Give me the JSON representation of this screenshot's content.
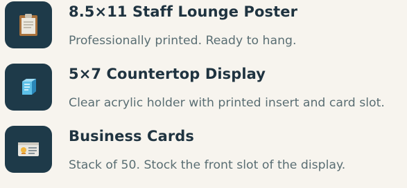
{
  "items": [
    {
      "title": "8.5×11 Staff Lounge Poster",
      "description": "Professionally printed. Ready to hang.",
      "icon": "clipboard-icon"
    },
    {
      "title": "5×7 Countertop Display",
      "description": "Clear acrylic holder with printed insert and card slot.",
      "icon": "acrylic-block-icon"
    },
    {
      "title": "Business Cards",
      "description": "Stack of 50. Stock the front slot of the display.",
      "icon": "id-card-icon"
    }
  ],
  "colors": {
    "background": "#f7f4ee",
    "tile": "#1e3a49",
    "title": "#1f3340",
    "description": "#5a6e73"
  }
}
